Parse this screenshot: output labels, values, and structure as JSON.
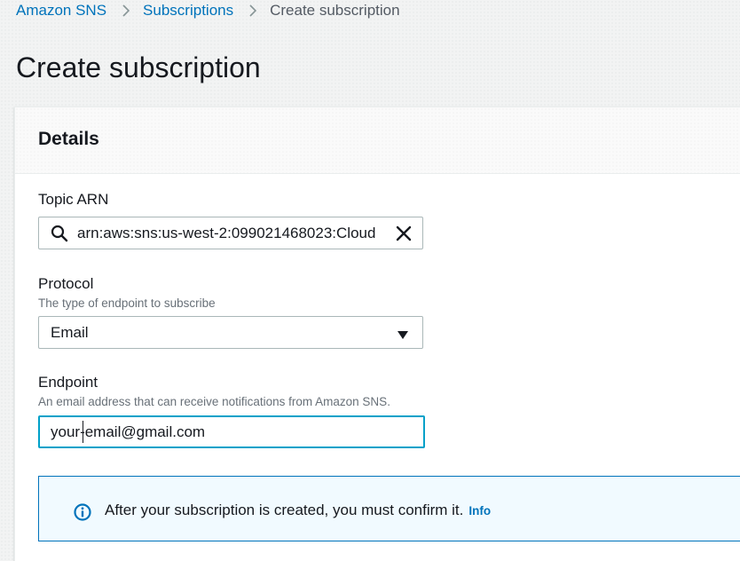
{
  "breadcrumb": {
    "items": [
      "Amazon SNS",
      "Subscriptions"
    ],
    "current": "Create subscription"
  },
  "page": {
    "title": "Create subscription"
  },
  "details": {
    "title": "Details",
    "topic_arn": {
      "label": "Topic ARN",
      "value": "arn:aws:sns:us-west-2:099021468023:Cloud"
    },
    "protocol": {
      "label": "Protocol",
      "description": "The type of endpoint to subscribe",
      "selected": "Email"
    },
    "endpoint": {
      "label": "Endpoint",
      "description": "An email address that can receive notifications from Amazon SNS.",
      "value": "your-email@gmail.com"
    }
  },
  "alert": {
    "message": "After your subscription is created, you must confirm it.",
    "info_link": "Info"
  },
  "colors": {
    "link": "#0073bb",
    "focus_border": "#00a1c9",
    "alert_border": "#0073bb",
    "alert_background": "#f1faff",
    "text": "#16191f",
    "muted_text": "#687078"
  },
  "icons": {
    "breadcrumb_separator": "chevron-right-icon",
    "topic_search": "search-icon",
    "topic_clear": "close-icon",
    "protocol_dropdown": "caret-down-icon",
    "alert": "info-circle-icon"
  }
}
